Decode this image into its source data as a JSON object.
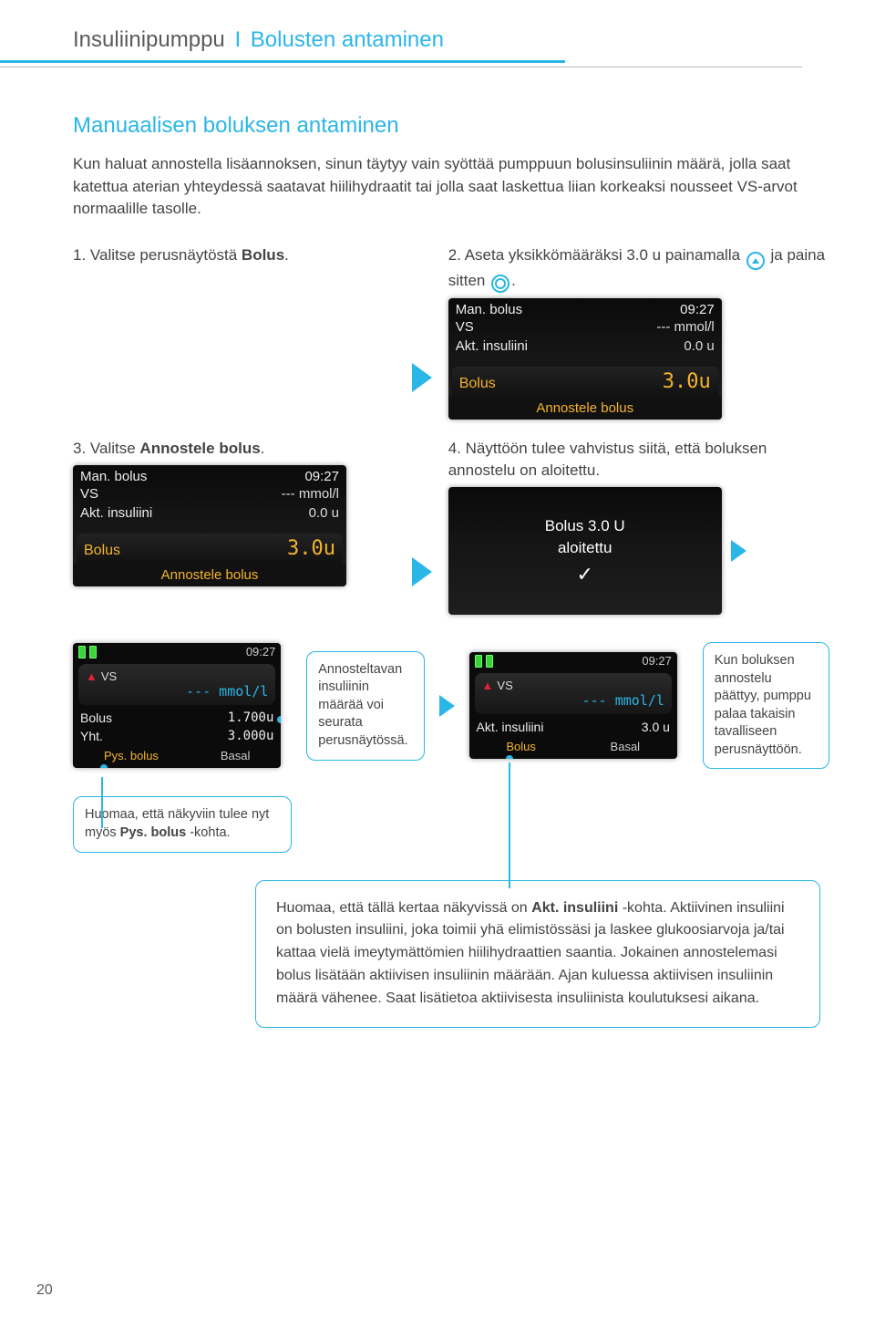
{
  "header": {
    "device": "Insuliinipumppu",
    "section": "Bolusten antaminen"
  },
  "title": "Manuaalisen boluksen antaminen",
  "intro": "Kun haluat annostella lisäannoksen, sinun täytyy vain syöttää pumppuun bolusinsuliinin määrä, jolla saat katettua aterian yhteydessä saatavat hiilihydraatit tai jolla saat laskettua liian korkeaksi nousseet VS-arvot normaalille tasolle.",
  "steps": {
    "s1": {
      "num": "1.",
      "textA": "Valitse perusnäytöstä ",
      "bold": "Bolus",
      "textB": "."
    },
    "s2": {
      "num": "2.",
      "textA": "Aseta yksikkömääräksi 3.0 u painamalla ",
      "textB": " ja paina sitten ",
      "textC": "."
    },
    "s3": {
      "num": "3.",
      "textA": "Valitse ",
      "bold": "Annostele bolus",
      "textB": "."
    },
    "s4": {
      "num": "4.",
      "text": "Näyttöön tulee vahvistus siitä, että boluksen annostelu on aloitettu."
    }
  },
  "screenA": {
    "title": "Man. bolus",
    "time": "09:27",
    "vs_lbl": "VS",
    "vs_val": "--- mmol/l",
    "akt_lbl": "Akt. insuliini",
    "akt_val": "0.0 u",
    "bolus_lbl": "Bolus",
    "bolus_val": "3.0u",
    "footer": "Annostele bolus"
  },
  "confirm": {
    "line1": "Bolus 3.0 U",
    "line2": "aloitettu",
    "check": "✓"
  },
  "home1": {
    "time": "09:27",
    "vs": "VS",
    "dash": "--- mmol/l",
    "bolus_lbl": "Bolus",
    "bolus_val": "1.700u",
    "yht_lbl": "Yht.",
    "yht_val": "3.000u",
    "btn1": "Pys. bolus",
    "btn2": "Basal"
  },
  "home2": {
    "time": "09:27",
    "vs": "VS",
    "dash": "--- mmol/l",
    "akt_lbl": "Akt. insuliini",
    "akt_val": "3.0 u",
    "btn1": "Bolus",
    "btn2": "Basal"
  },
  "callouts": {
    "c1": "Annosteltavan insuliinin määrää voi seurata perusnäytössä.",
    "c2": "Kun boluksen annostelu päättyy, pumppu palaa takaisin tavalliseen perusnäyttöön.",
    "c3a": "Huomaa, että näkyviin tulee nyt myös ",
    "c3b": "Pys. bolus",
    "c3c": " -kohta.",
    "c4a": "Huomaa, että tällä kertaa näkyvissä on ",
    "c4b": "Akt. insuliini",
    "c4c": " -kohta. Aktiivinen insuliini on bolusten insuliini, joka toimii yhä elimistössäsi ja laskee glukoosiarvoja ja/tai kattaa vielä imeytymättömien hiilihydraattien saantia. Jokainen annostelemasi bolus lisätään aktiivisen insuliinin määrään. Ajan kuluessa aktiivisen insuliinin määrä vähenee. Saat lisätietoa aktiivisesta insuliinista koulutuksesi aikana."
  },
  "page": "20"
}
